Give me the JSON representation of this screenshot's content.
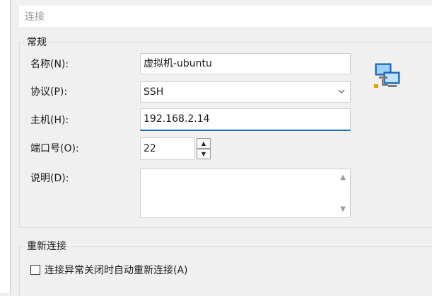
{
  "header": {
    "title": "连接"
  },
  "general": {
    "title": "常规",
    "name_label": "名称(N):",
    "name_value": "虚拟机-ubuntu",
    "protocol_label": "协议(P):",
    "protocol_value": "SSH",
    "host_label": "主机(H):",
    "host_value": "192.168.2.14",
    "port_label": "端口号(O):",
    "port_value": "22",
    "desc_label": "说明(D):",
    "desc_value": ""
  },
  "reconnect": {
    "title": "重新连接",
    "auto_reconnect_label": "连接异常关闭时自动重新连接(A)",
    "auto_reconnect_checked": false
  },
  "icons": {
    "network": "network-computers-icon",
    "select": "chevron-down-icon",
    "spin_up": "spin-up-icon",
    "spin_down": "spin-down-icon",
    "scroll_up": "scroll-up-icon",
    "scroll_down": "scroll-down-icon"
  },
  "colors": {
    "accent": "#1f6fb5",
    "background": "#f0f0f0",
    "header_text": "#9a9a9a"
  }
}
